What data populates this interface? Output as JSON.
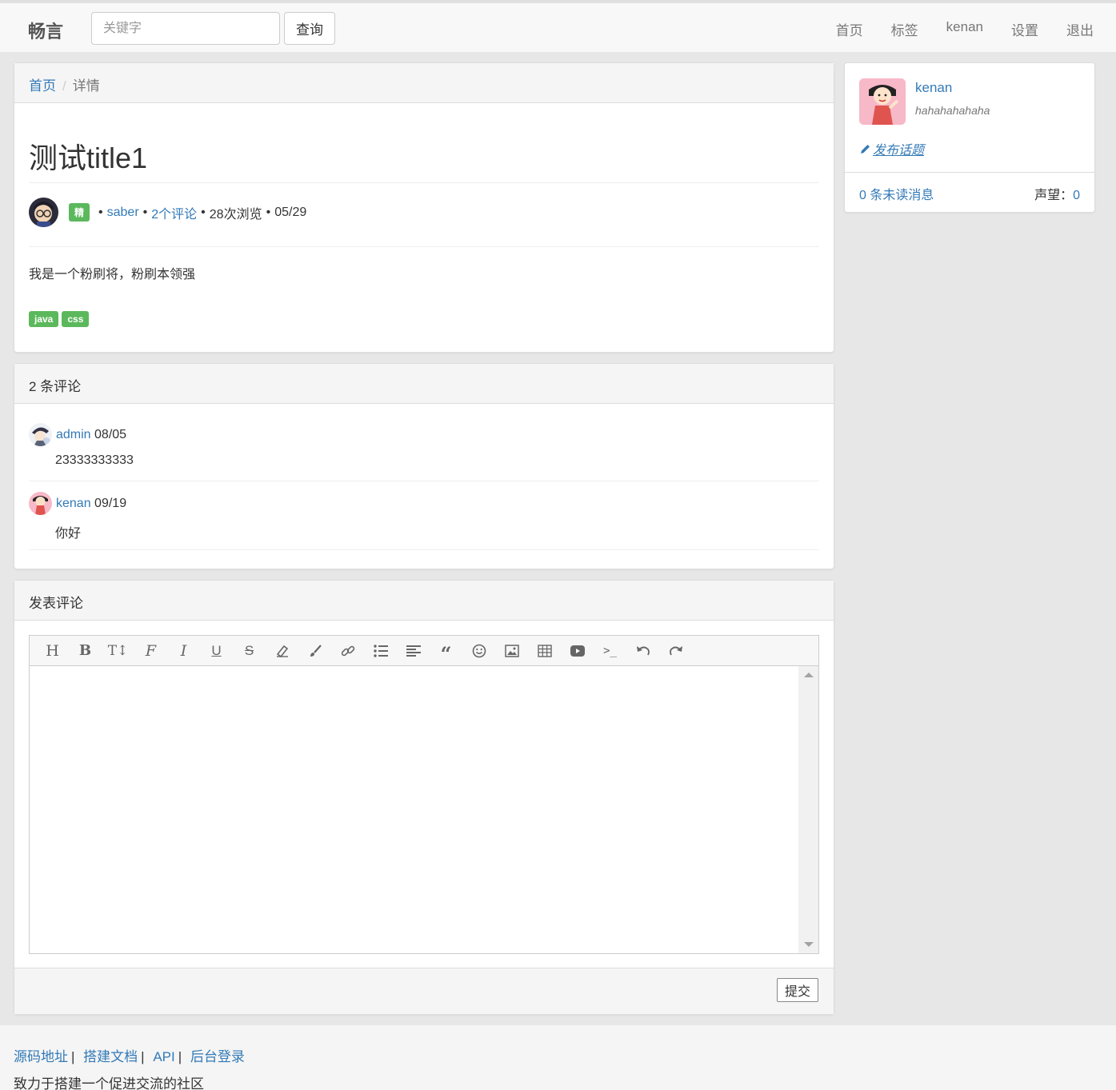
{
  "nav": {
    "brand": "畅言",
    "search_placeholder": "关键字",
    "search_button": "查询",
    "links": [
      "首页",
      "标签",
      "kenan",
      "设置",
      "退出"
    ]
  },
  "breadcrumb": {
    "home": "首页",
    "current": "详情"
  },
  "topic": {
    "title": "测试title1",
    "badge": "精",
    "author": "saber",
    "comments_link": "2个评论",
    "views": "28次浏览",
    "date": "05/29",
    "content": "我是一个粉刷将，粉刷本领强",
    "tags": [
      "java",
      "css"
    ]
  },
  "comments": {
    "header": "2 条评论",
    "items": [
      {
        "user": "admin",
        "date": "08/05",
        "text": "23333333333"
      },
      {
        "user": "kenan",
        "date": "09/19",
        "text": "你好"
      }
    ]
  },
  "reply": {
    "header": "发表评论",
    "submit": "提交",
    "toolbar": [
      "heading-icon",
      "bold-icon",
      "font-size-icon",
      "font-family-icon",
      "italic-icon",
      "underline-icon",
      "strikethrough-icon",
      "eraser-icon",
      "brush-icon",
      "link-icon",
      "list-icon",
      "align-icon",
      "quote-icon",
      "emoji-icon",
      "image-icon",
      "table-icon",
      "video-icon",
      "code-icon",
      "undo-icon",
      "redo-icon"
    ]
  },
  "user": {
    "name": "kenan",
    "signature": "hahahahahaha",
    "new_topic": "发布话题",
    "unread": "0 条未读消息",
    "reputation_label": "声望：",
    "reputation_value": "0"
  },
  "footer": {
    "links": [
      "源码地址",
      "搭建文档",
      "API",
      "后台登录"
    ],
    "tagline": "致力于搭建一个促进交流的社区"
  }
}
